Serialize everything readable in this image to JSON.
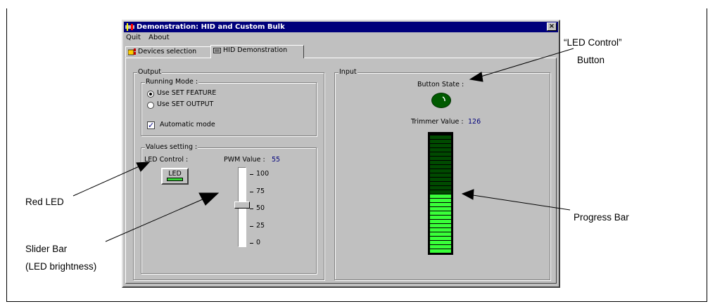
{
  "window": {
    "title": "Demonstration: HID and Custom Bulk",
    "close_glyph": "×",
    "menu": [
      "Quit",
      "About"
    ],
    "tabs": [
      "Devices selection",
      "HID Demonstration"
    ],
    "active_tab": "HID Demonstration"
  },
  "output": {
    "group_label": "Output",
    "running_mode_label": "Running Mode :",
    "radio_options": [
      "Use SET FEATURE",
      "Use SET OUTPUT"
    ],
    "selected_radio": "Use SET FEATURE",
    "automatic_mode_label": "Automatic mode",
    "automatic_mode_checked": true,
    "values_setting_label": "Values setting :",
    "led_control_label": "LED Control :",
    "led_button_label": "LED",
    "pwm_label": "PWM Value :",
    "pwm_value": "55",
    "slider_value": 55,
    "slider_ticks": [
      "100",
      "75",
      "50",
      "25",
      "0"
    ]
  },
  "input": {
    "group_label": "Input",
    "button_state_label": "Button State :",
    "trimmer_label": "Trimmer Value :",
    "trimmer_value": "126",
    "progress_fraction": 0.49
  },
  "annotations": {
    "led_control_button": [
      "“LED Control”",
      "Button"
    ],
    "red_led": "Red LED",
    "slider_bar": [
      "Slider Bar",
      "(LED brightness)"
    ],
    "progress_bar": "Progress Bar"
  },
  "colors": {
    "titlebar": "#00007b",
    "window_face": "#c0c0c0",
    "led_on": "#39ff39",
    "led_off": "#004a00"
  }
}
